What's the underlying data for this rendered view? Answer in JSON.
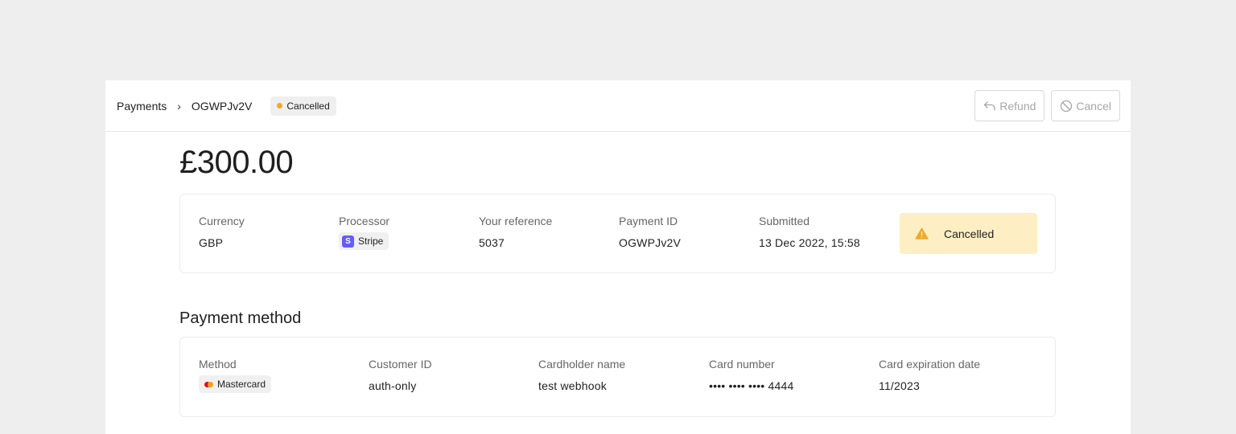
{
  "breadcrumb": {
    "root": "Payments",
    "separator": "›",
    "current": "OGWPJv2V"
  },
  "status": {
    "label": "Cancelled",
    "dot_color": "#f5a623"
  },
  "actions": {
    "refund_label": "Refund",
    "cancel_label": "Cancel"
  },
  "payment": {
    "amount": "£300.00"
  },
  "summary": {
    "currency": {
      "label": "Currency",
      "value": "GBP"
    },
    "processor": {
      "label": "Processor",
      "value": "Stripe",
      "logo_letter": "S"
    },
    "reference": {
      "label": "Your reference",
      "value": "5037"
    },
    "payment_id": {
      "label": "Payment ID",
      "value": "OGWPJv2V"
    },
    "submitted": {
      "label": "Submitted",
      "value": "13 Dec 2022, 15:58"
    },
    "alert": {
      "label": "Cancelled",
      "icon": "warning-icon",
      "color": "#f0a928"
    }
  },
  "payment_method": {
    "title": "Payment method",
    "method": {
      "label": "Method",
      "value": "Mastercard"
    },
    "customer_id": {
      "label": "Customer ID",
      "value": "auth-only"
    },
    "cardholder": {
      "label": "Cardholder name",
      "value": "test webhook"
    },
    "card_number": {
      "label": "Card number",
      "value": "•••• •••• •••• 4444"
    },
    "expiry": {
      "label": "Card expiration date",
      "value": "11/2023"
    }
  }
}
